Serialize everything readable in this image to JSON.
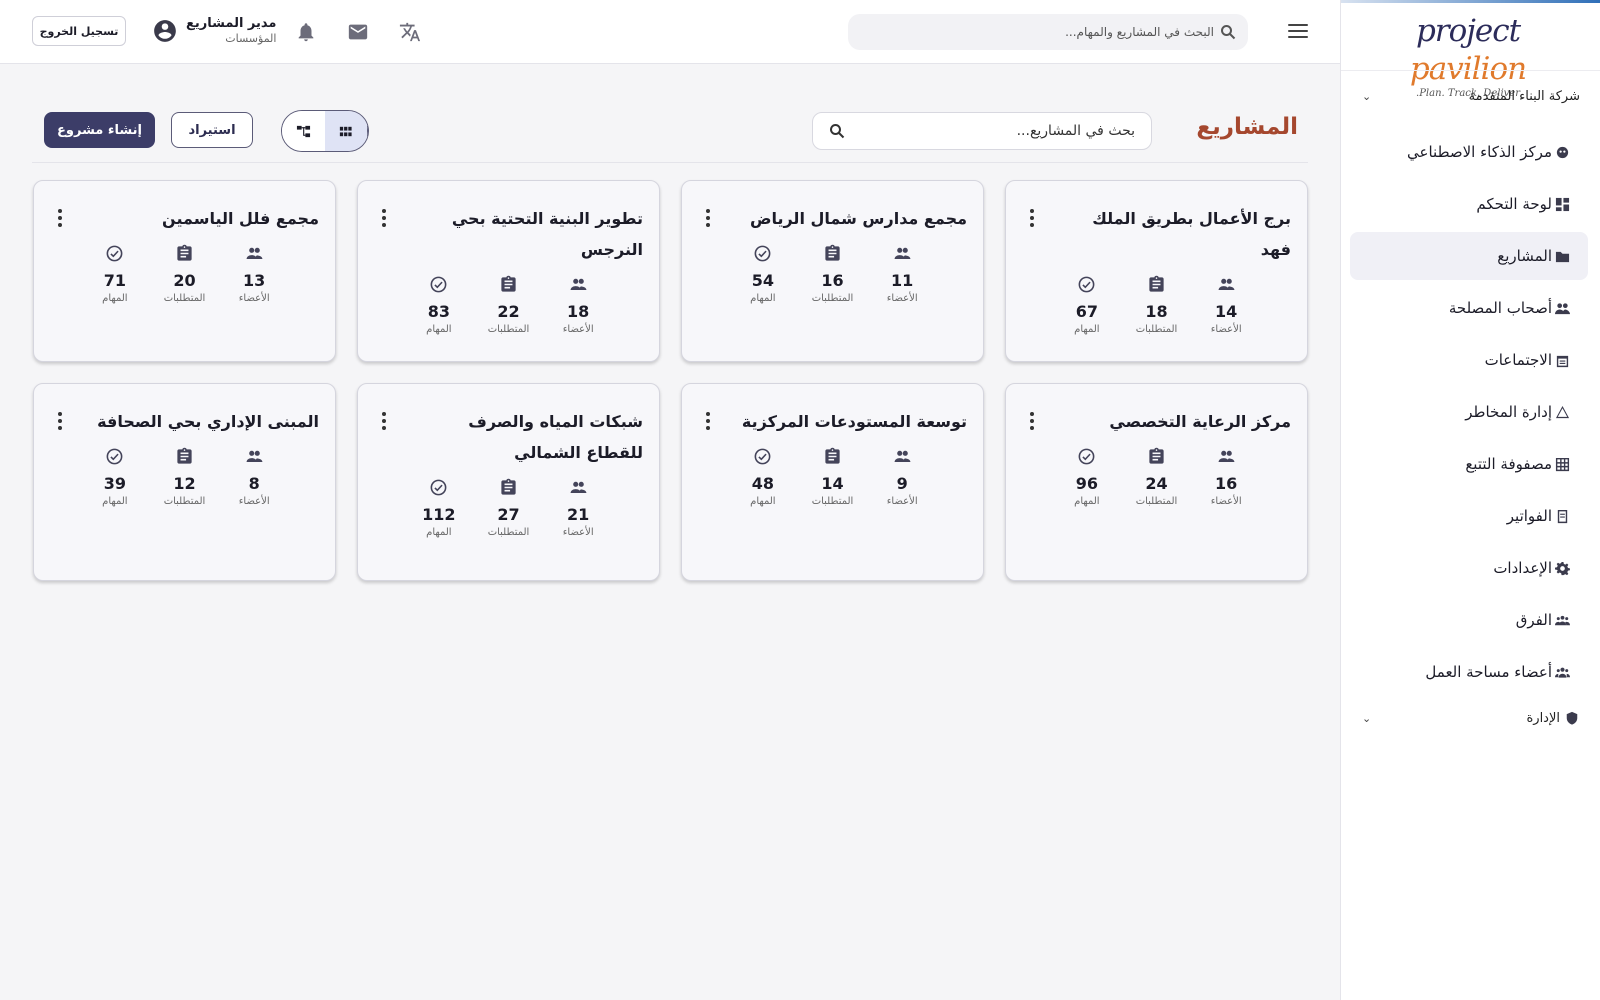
{
  "brand": {
    "name_part1": "project",
    "name_part2": "pavilion",
    "tagline": "Plan. Track. Deliver."
  },
  "sidebar": {
    "company": "شركة البناء المتقدمة",
    "items": [
      {
        "label": "مركز الذكاء الاصطناعي",
        "icon": "ai-brain-icon"
      },
      {
        "label": "لوحة التحكم",
        "icon": "dashboard-icon"
      },
      {
        "label": "المشاريع",
        "icon": "folder-icon",
        "active": true
      },
      {
        "label": "أصحاب المصلحة",
        "icon": "people-icon"
      },
      {
        "label": "الاجتماعات",
        "icon": "calendar-icon"
      },
      {
        "label": "إدارة المخاطر",
        "icon": "warning-icon"
      },
      {
        "label": "مصفوفة التتبع",
        "icon": "grid-icon"
      },
      {
        "label": "الفواتير",
        "icon": "receipt-icon"
      },
      {
        "label": "الإعدادات",
        "icon": "gear-icon"
      },
      {
        "label": "الفرق",
        "icon": "groups-icon"
      },
      {
        "label": "أعضاء مساحة العمل",
        "icon": "members-icon"
      }
    ],
    "admin": "الإدارة"
  },
  "header": {
    "search_placeholder": "البحث في المشاريع والمهام...",
    "user_name": "مدير المشاريع",
    "user_role": "المؤسسات",
    "logout": "تسجيل الخروج"
  },
  "page": {
    "title": "المشاريع",
    "search_placeholder": "بحث في المشاريع...",
    "import": "استيراد",
    "create": "إنشاء مشروع"
  },
  "labels": {
    "members": "الأعضاء",
    "requirements": "المتطلبات",
    "tasks": "المهام"
  },
  "projects": [
    {
      "title": "برج الأعمال بطريق الملك فهد",
      "members": 14,
      "requirements": 18,
      "tasks": 67
    },
    {
      "title": "مجمع مدارس شمال الرياض",
      "members": 11,
      "requirements": 16,
      "tasks": 54
    },
    {
      "title": "تطوير البنية التحتية بحي النرجس",
      "members": 18,
      "requirements": 22,
      "tasks": 83
    },
    {
      "title": "مجمع فلل الياسمين",
      "members": 13,
      "requirements": 20,
      "tasks": 71
    },
    {
      "title": "مركز الرعاية التخصصي",
      "members": 16,
      "requirements": 24,
      "tasks": 96
    },
    {
      "title": "توسعة المستودعات المركزية",
      "members": 9,
      "requirements": 14,
      "tasks": 48
    },
    {
      "title": "شبكات المياه والصرف للقطاع الشمالي",
      "members": 21,
      "requirements": 27,
      "tasks": 112
    },
    {
      "title": "المبنى الإداري بحي الصحافة",
      "members": 8,
      "requirements": 12,
      "tasks": 39
    }
  ],
  "colors": {
    "accent": "#3c3d68",
    "title": "#a5472e",
    "brand_orange": "#e07a2c",
    "brand_navy": "#2c2c5a"
  }
}
